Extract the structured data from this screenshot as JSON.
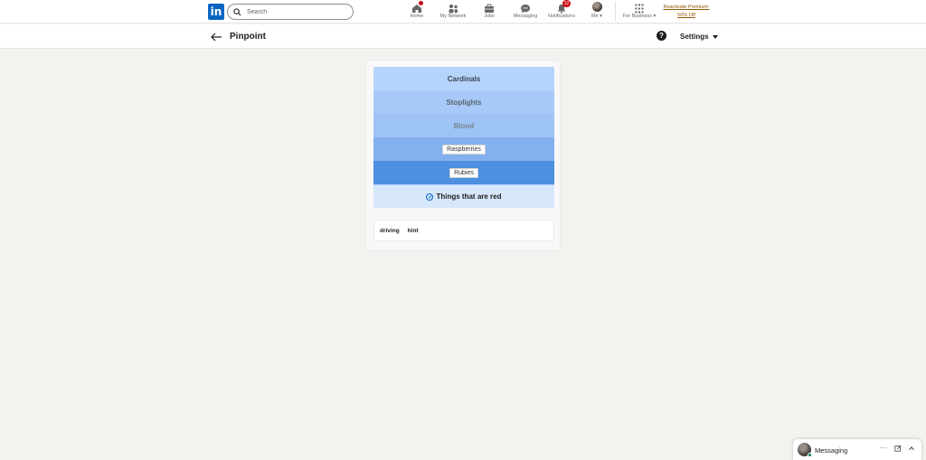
{
  "nav": {
    "logo": "in",
    "search_placeholder": "Search",
    "items": [
      {
        "label": "Home",
        "icon": "home-icon"
      },
      {
        "label": "My Network",
        "icon": "network-icon"
      },
      {
        "label": "Jobs",
        "icon": "briefcase-icon"
      },
      {
        "label": "Messaging",
        "icon": "chat-icon"
      },
      {
        "label": "Notifications",
        "icon": "bell-icon",
        "badge": "12"
      },
      {
        "label": "Me",
        "icon": "avatar"
      },
      {
        "label": "For Business",
        "icon": "grid-icon"
      }
    ],
    "premium_line1": "Reactivate Premium:",
    "premium_line2": "50% Off"
  },
  "header": {
    "title": "Pinpoint",
    "settings_label": "Settings"
  },
  "game": {
    "clues": [
      "Cardinals",
      "Stoplights",
      "Blood",
      "Raspberries",
      "Rubies"
    ],
    "answer": "Things that are red",
    "guesses": [
      "driving",
      "hint"
    ]
  },
  "messaging": {
    "label": "Messaging"
  },
  "colors": {
    "brand": "#0a66c2",
    "badge": "#cc1016",
    "premium": "#915907"
  }
}
